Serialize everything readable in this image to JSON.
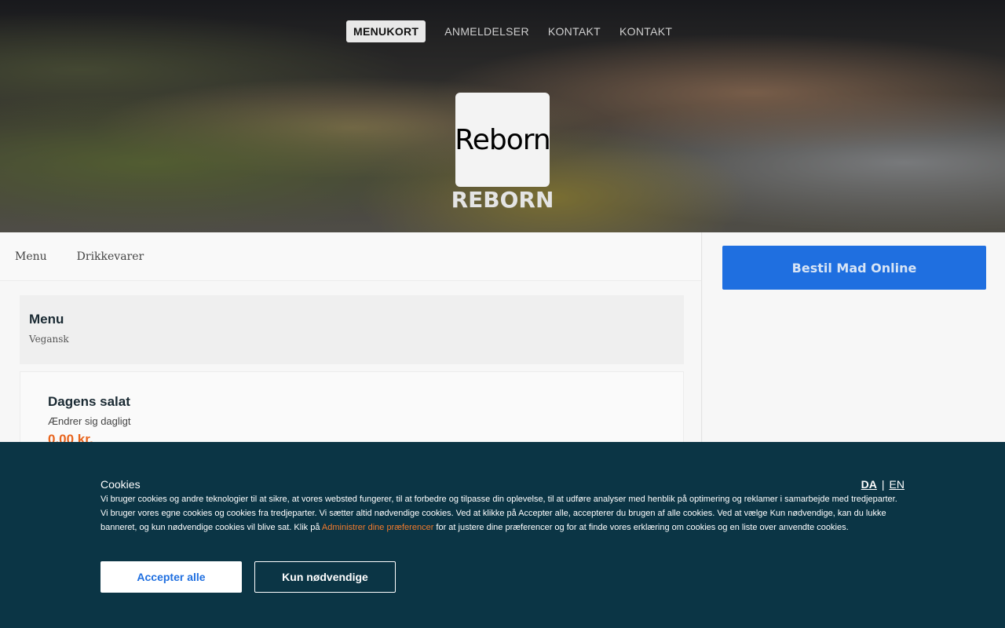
{
  "topnav": {
    "items": [
      {
        "label": "MENUKORT",
        "active": true
      },
      {
        "label": "ANMELDELSER",
        "active": false
      },
      {
        "label": "KONTAKT",
        "active": false
      },
      {
        "label": "KONTAKT",
        "active": false
      }
    ]
  },
  "hero": {
    "logo_text": "Reborn",
    "brand_name": "REBORN"
  },
  "category_tabs": [
    "Menu",
    "Drikkevarer"
  ],
  "section": {
    "title": "Menu",
    "subtitle": "Vegansk"
  },
  "items": [
    {
      "title": "Dagens salat",
      "description": "Ændrer sig dagligt",
      "price": "0,00 kr."
    }
  ],
  "sidebar": {
    "order_button": "Bestil Mad Online"
  },
  "cookie_banner": {
    "title": "Cookies",
    "lang_da": "DA",
    "lang_separator": "|",
    "lang_en": "EN",
    "text_before_link": "Vi bruger cookies og andre teknologier til at sikre, at vores websted fungerer, til at forbedre og tilpasse din oplevelse, til at udføre analyser med henblik på optimering og reklamer i samarbejde med tredjeparter. Vi bruger vores egne cookies og cookies fra tredjeparter. Vi sætter altid nødvendige cookies. Ved at klikke på Accepter alle, accepterer du brugen af alle cookies. Ved at vælge Kun nødvendige, kan du lukke banneret, og kun nødvendige cookies vil blive sat. Klik på ",
    "link_text": "Administrer dine præferencer",
    "text_after_link": " for at justere dine præferencer og for at finde vores erklæring om cookies og en liste over anvendte cookies.",
    "accept_all": "Accepter alle",
    "only_necessary": "Kun nødvendige"
  },
  "colors": {
    "banner_bg": "#0b3545",
    "accent_blue": "#1f6fe0",
    "price_orange": "#e8641d",
    "link_orange": "#f07a2d"
  }
}
